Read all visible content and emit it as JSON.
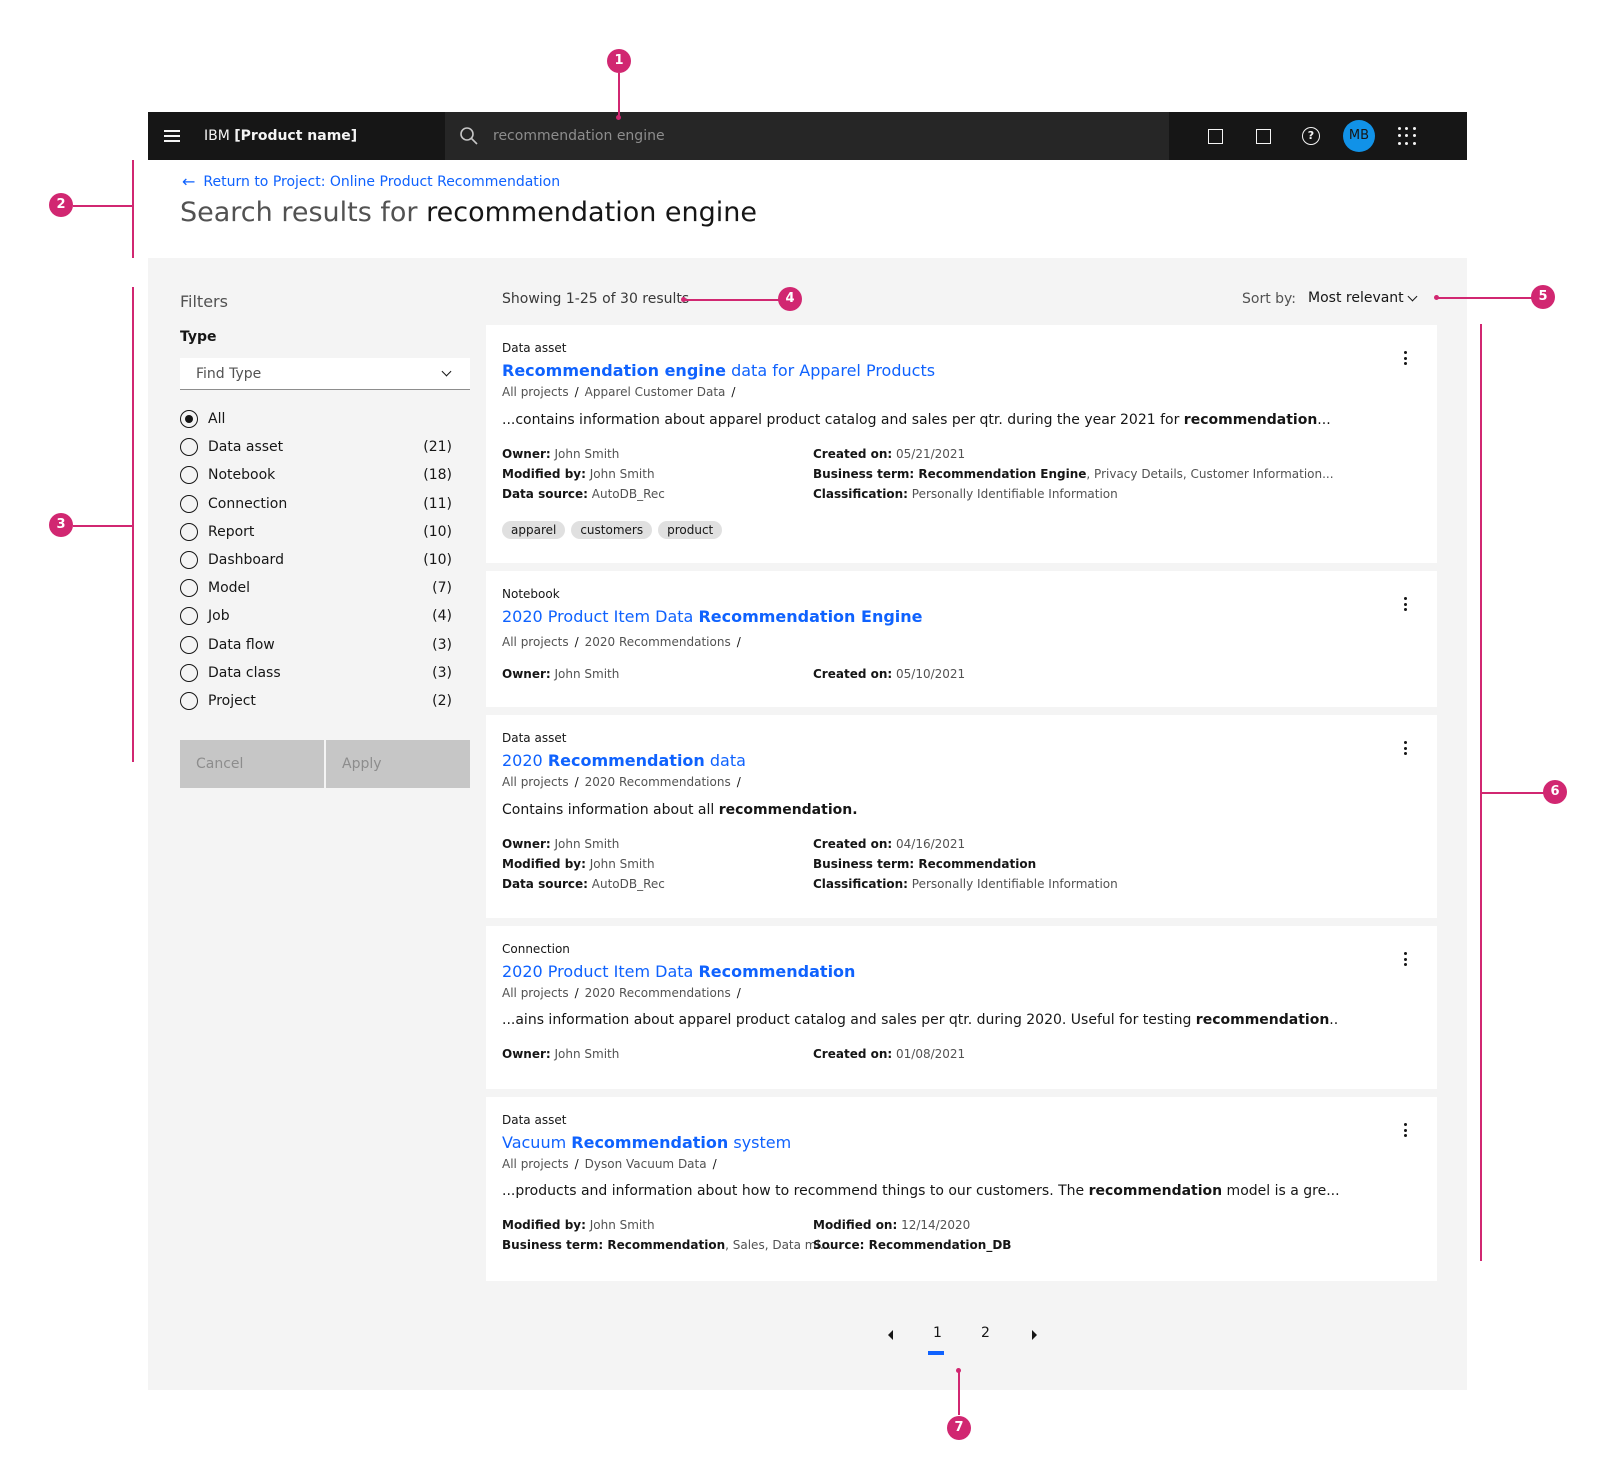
{
  "header": {
    "brand_prefix": "IBM",
    "brand_product": "[Product name]",
    "search_placeholder": "recommendation engine",
    "avatar_initials": "MB"
  },
  "page": {
    "back_link": "Return to Project: Online Product Recommendation",
    "title_prefix": "Search results for",
    "title_query": "recommendation engine"
  },
  "filters": {
    "title": "Filters",
    "type_label": "Type",
    "dropdown_placeholder": "Find Type",
    "options": [
      {
        "label": "All",
        "count": "",
        "selected": true
      },
      {
        "label": "Data asset",
        "count": "(21)"
      },
      {
        "label": "Notebook",
        "count": "(18)"
      },
      {
        "label": "Connection",
        "count": "(11)"
      },
      {
        "label": "Report",
        "count": "(10)"
      },
      {
        "label": "Dashboard",
        "count": "(10)"
      },
      {
        "label": "Model",
        "count": "(7)"
      },
      {
        "label": "Job",
        "count": "(4)"
      },
      {
        "label": "Data flow",
        "count": "(3)"
      },
      {
        "label": "Data class",
        "count": "(3)"
      },
      {
        "label": "Project",
        "count": "(2)"
      }
    ],
    "cancel_label": "Cancel",
    "apply_label": "Apply"
  },
  "results": {
    "count_text": "Showing 1-25 of 30 results",
    "sort_label": "Sort by:",
    "sort_value": "Most relevant",
    "cards": [
      {
        "kind": "Data asset",
        "title_bold": "Recommendation engine",
        "title_rest": " data for Apparel Products",
        "crumb_root": "All projects",
        "crumb_item": "Apparel Customer Data",
        "desc_pre": "...contains information about apparel product catalog and sales per qtr. during the year 2021 for ",
        "desc_bold": "recommendation",
        "desc_post": "...",
        "owner_label": "Owner:",
        "owner": " John Smith",
        "modified_label": "Modified by:",
        "modified": " John Smith",
        "source_label": "Data source:",
        "source": " AutoDB_Rec",
        "created_label": "Created on:",
        "created": " 05/21/2021",
        "term_label": "Business term:",
        "term_bold": " Recommendation Engine",
        "term_rest": ", Privacy Details, Customer Information...",
        "class_label": "Classification:",
        "class": " Personally Identifiable Information",
        "tags": [
          "apparel",
          "customers",
          "product"
        ]
      },
      {
        "kind": "Notebook",
        "title_pre": "2020 Product Item Data ",
        "title_bold": "Recommendation Engine",
        "crumb_root": "All projects",
        "crumb_item": "2020 Recommendations",
        "owner_label": "Owner:",
        "owner": " John Smith",
        "created_label": "Created on:",
        "created": " 05/10/2021"
      },
      {
        "kind": "Data asset",
        "title_pre": "2020 ",
        "title_bold": "Recommendation",
        "title_rest": " data",
        "crumb_root": "All projects",
        "crumb_item": "2020 Recommendations",
        "desc_pre": "Contains information about all ",
        "desc_bold": "recommendation.",
        "owner_label": "Owner:",
        "owner": " John Smith",
        "modified_label": "Modified by:",
        "modified": " John Smith",
        "source_label": "Data source:",
        "source": " AutoDB_Rec",
        "created_label": "Created on:",
        "created": " 04/16/2021",
        "term_label": "Business term:",
        "term_bold": " Recommendation",
        "class_label": "Classification:",
        "class": " Personally Identifiable Information"
      },
      {
        "kind": "Connection",
        "title_pre": "2020 Product Item Data ",
        "title_bold": "Recommendation",
        "crumb_root": "All projects",
        "crumb_item": "2020 Recommendations",
        "desc_pre": "...ains information about apparel product catalog and sales per qtr. during 2020. Useful for testing ",
        "desc_bold": "recommendation",
        "desc_post": "..",
        "owner_label": "Owner:",
        "owner": " John Smith",
        "created_label": "Created on:",
        "created": " 01/08/2021"
      },
      {
        "kind": "Data asset",
        "title_pre": "Vacuum ",
        "title_bold": "Recommendation",
        "title_rest": " system",
        "crumb_root": "All projects",
        "crumb_item": "Dyson Vacuum Data",
        "desc_pre": "...products and information about how to recommend things to our customers. The ",
        "desc_bold": "recommendation",
        "desc_post": " model is a gre...",
        "modified_label": "Modified by:",
        "modified": " John Smith",
        "term_label": "Business term:",
        "term_bold": " Recommendation",
        "term_rest": ", Sales, Data mi...",
        "modon_label": "Modified on:",
        "modon": " 12/14/2020",
        "src_label": "Source:",
        "src_bold": " Recommendation_DB"
      }
    ]
  },
  "pagination": {
    "pages": [
      "1",
      "2"
    ],
    "current": "1"
  },
  "annotations": [
    "1",
    "2",
    "3",
    "4",
    "5",
    "6",
    "7"
  ],
  "colors": {
    "header_bg": "#161616",
    "link": "#0f62fe",
    "annotation": "#d12771",
    "panel_bg": "#f4f4f4",
    "avatar": "#1192e8"
  }
}
